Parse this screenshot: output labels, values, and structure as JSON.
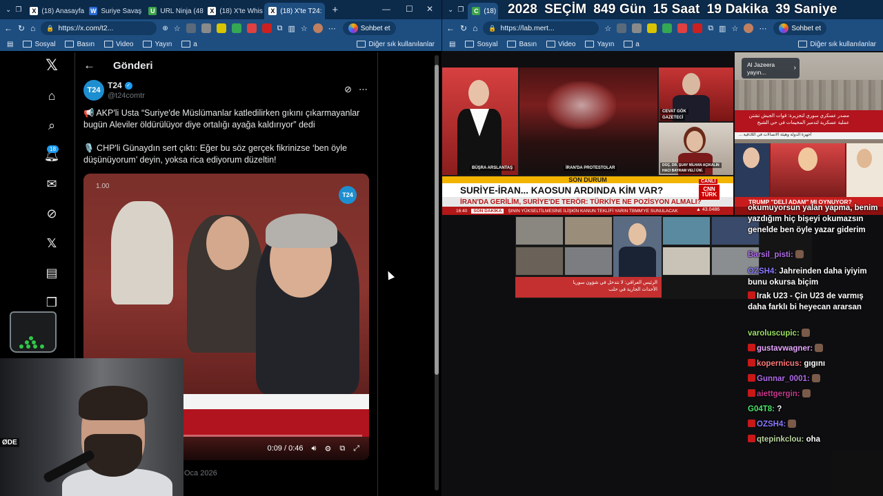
{
  "left_window": {
    "tabs": [
      {
        "favicon": "X",
        "label": "(18) Anasayfa"
      },
      {
        "favicon": "W",
        "label": "Suriye Savaş"
      },
      {
        "favicon": "U",
        "label": "URL Ninja (48)"
      },
      {
        "favicon": "X",
        "label": "(18) X'te Whis"
      },
      {
        "favicon": "X",
        "label": "(18) X'te T24:"
      }
    ],
    "url": "https://x.com/t2...",
    "chat_button": "Sohbet et",
    "bookmarks": [
      "Sosyal",
      "Basın",
      "Video",
      "Yayın",
      "a"
    ],
    "bookmarks_right": "Diğer sık kullanılanlar"
  },
  "x_page": {
    "header_title": "Gönderi",
    "notification_count": "18",
    "author_name": "T24",
    "author_handle": "@t24comtr",
    "avatar_text": "T24",
    "paragraph_1": "📢 AKP'li Usta “Suriye'de Müslümanlar katledilirken gıkını çıkarmayanlar bugün Aleviler öldürülüyor diye ortalığı ayağa kaldırıyor” dedi",
    "paragraph_2": "🎙️ CHP'li Günaydın sert çıktı: Eğer bu söz gerçek fikrinizse ‘ben öyle düşünüyorum’ deyin, yoksa rica ediyorum düzeltin!",
    "video_speed": "1.00",
    "video_badge": "T24",
    "video_time": "0:09 / 0:46",
    "video_progress": 0.2,
    "post_date": "Oca 2026"
  },
  "webcam": {
    "label": "ØDE"
  },
  "right_window": {
    "tab_label": "(18) C",
    "countdown": [
      "2028",
      "SEÇİM",
      "849 Gün",
      "15 Saat",
      "19 Dakika",
      "39 Saniye"
    ],
    "url": "https://lab.mert...",
    "chat_button": "Sohbet et",
    "bookmarks": [
      "Sosyal",
      "Basın",
      "Video",
      "Yayın",
      "a"
    ],
    "bookmarks_right": "Diğer sık kullanılanlar"
  },
  "tv_cnn": {
    "name_anchor": "BÜŞRA ARSLANTAŞ",
    "name_scene": "İRAN'DA PROTESTOLAR",
    "name_guest1_line1": "CEVAT GÖK",
    "name_guest1_line2": "GAZETECİ",
    "name_guest2_line1": "DOÇ. DR. ŞUAY NİLHAN AÇIKALIN",
    "name_guest2_line2": "HACI BAYRAM VELİ ÜNİ.",
    "banner_top": "SON DURUM",
    "headline": "SURİYE-İRAN... KAOSUN ARDINDA KİM VAR?",
    "subheadline": "İRAN'DA GERİLİM, SURİYE'DE TERÖR: TÜRKİYE NE POZİSYON ALMALI?",
    "ticker_time": "16:40",
    "ticker_label": "SON DAKİKA",
    "ticker_text": "ŞININ YÜKSELTİLMESİNE İLİŞKİN KANUN TEKLİFİ YARIN TBMM'YE SUNULACAK",
    "live_label": "CANLI",
    "logo_line1": "CNN",
    "logo_line2": "TÜRK",
    "stock_value": "▲ 43.0486"
  },
  "tv_aljazeera": {
    "pill_line1": "Al Jazeera",
    "pill_line2": "yayın...",
    "arabic_line1": "مصدر عسكري سوري لتجزيرة: قوات الجيش تشتن",
    "arabic_line2": "عملية عسكرية لتدمير المخيمات في حي الشيخ",
    "bottom": "... أجهزة الدولة وهيئة الاتصالات في اللاذقية"
  },
  "tv_third": {
    "caption": "TRUMP \"DELİ ADAM\" MI OYNUYOR?"
  },
  "tv_fourth": {
    "caption_line1": "الرئيس العراقي: لا نتدخل في شؤون سوريا",
    "caption_line2": "الأحداث الجارية في حلب"
  },
  "chat": [
    {
      "user": "",
      "text": "okumuyorsun yalan yapma, benim yazdığım hiç bişeyi okumazsın genelde ben öyle yazar giderim",
      "color": "#ffffff",
      "mod": false
    },
    {
      "user": "Barsil_pisti:",
      "text": "",
      "color": "#b06de8",
      "mod": false
    },
    {
      "user": "OZSH4:",
      "text": "Jahreinden daha iyiyim bunu okursa biçim",
      "color": "#8a79ff",
      "mod": false
    },
    {
      "user": "",
      "text": "Irak U23 - Çin U23 de varmış daha farklı bi heyecan ararsan",
      "color": "#ffffff",
      "mod": true
    },
    {
      "user": "varoluscupic:",
      "text": "",
      "color": "#9adf63",
      "mod": false
    },
    {
      "user": "gustavwagner:",
      "text": "",
      "color": "#e8a8ff",
      "mod": true
    },
    {
      "user": "kopernicus:",
      "text": "gıgını",
      "color": "#ff7a7a",
      "mod": true
    },
    {
      "user": "Gunnar_0001:",
      "text": "",
      "color": "#b06de8",
      "mod": true
    },
    {
      "user": "aiettgergin:",
      "text": "",
      "color": "#c23b8a",
      "mod": true
    },
    {
      "user": "G04T8:",
      "text": "?",
      "color": "#4ae36a",
      "mod": false
    },
    {
      "user": "OZSH4:",
      "text": "",
      "color": "#8a79ff",
      "mod": true
    },
    {
      "user": "qtepinkclou:",
      "text": "oha",
      "color": "#b9d3a0",
      "mod": true
    }
  ]
}
